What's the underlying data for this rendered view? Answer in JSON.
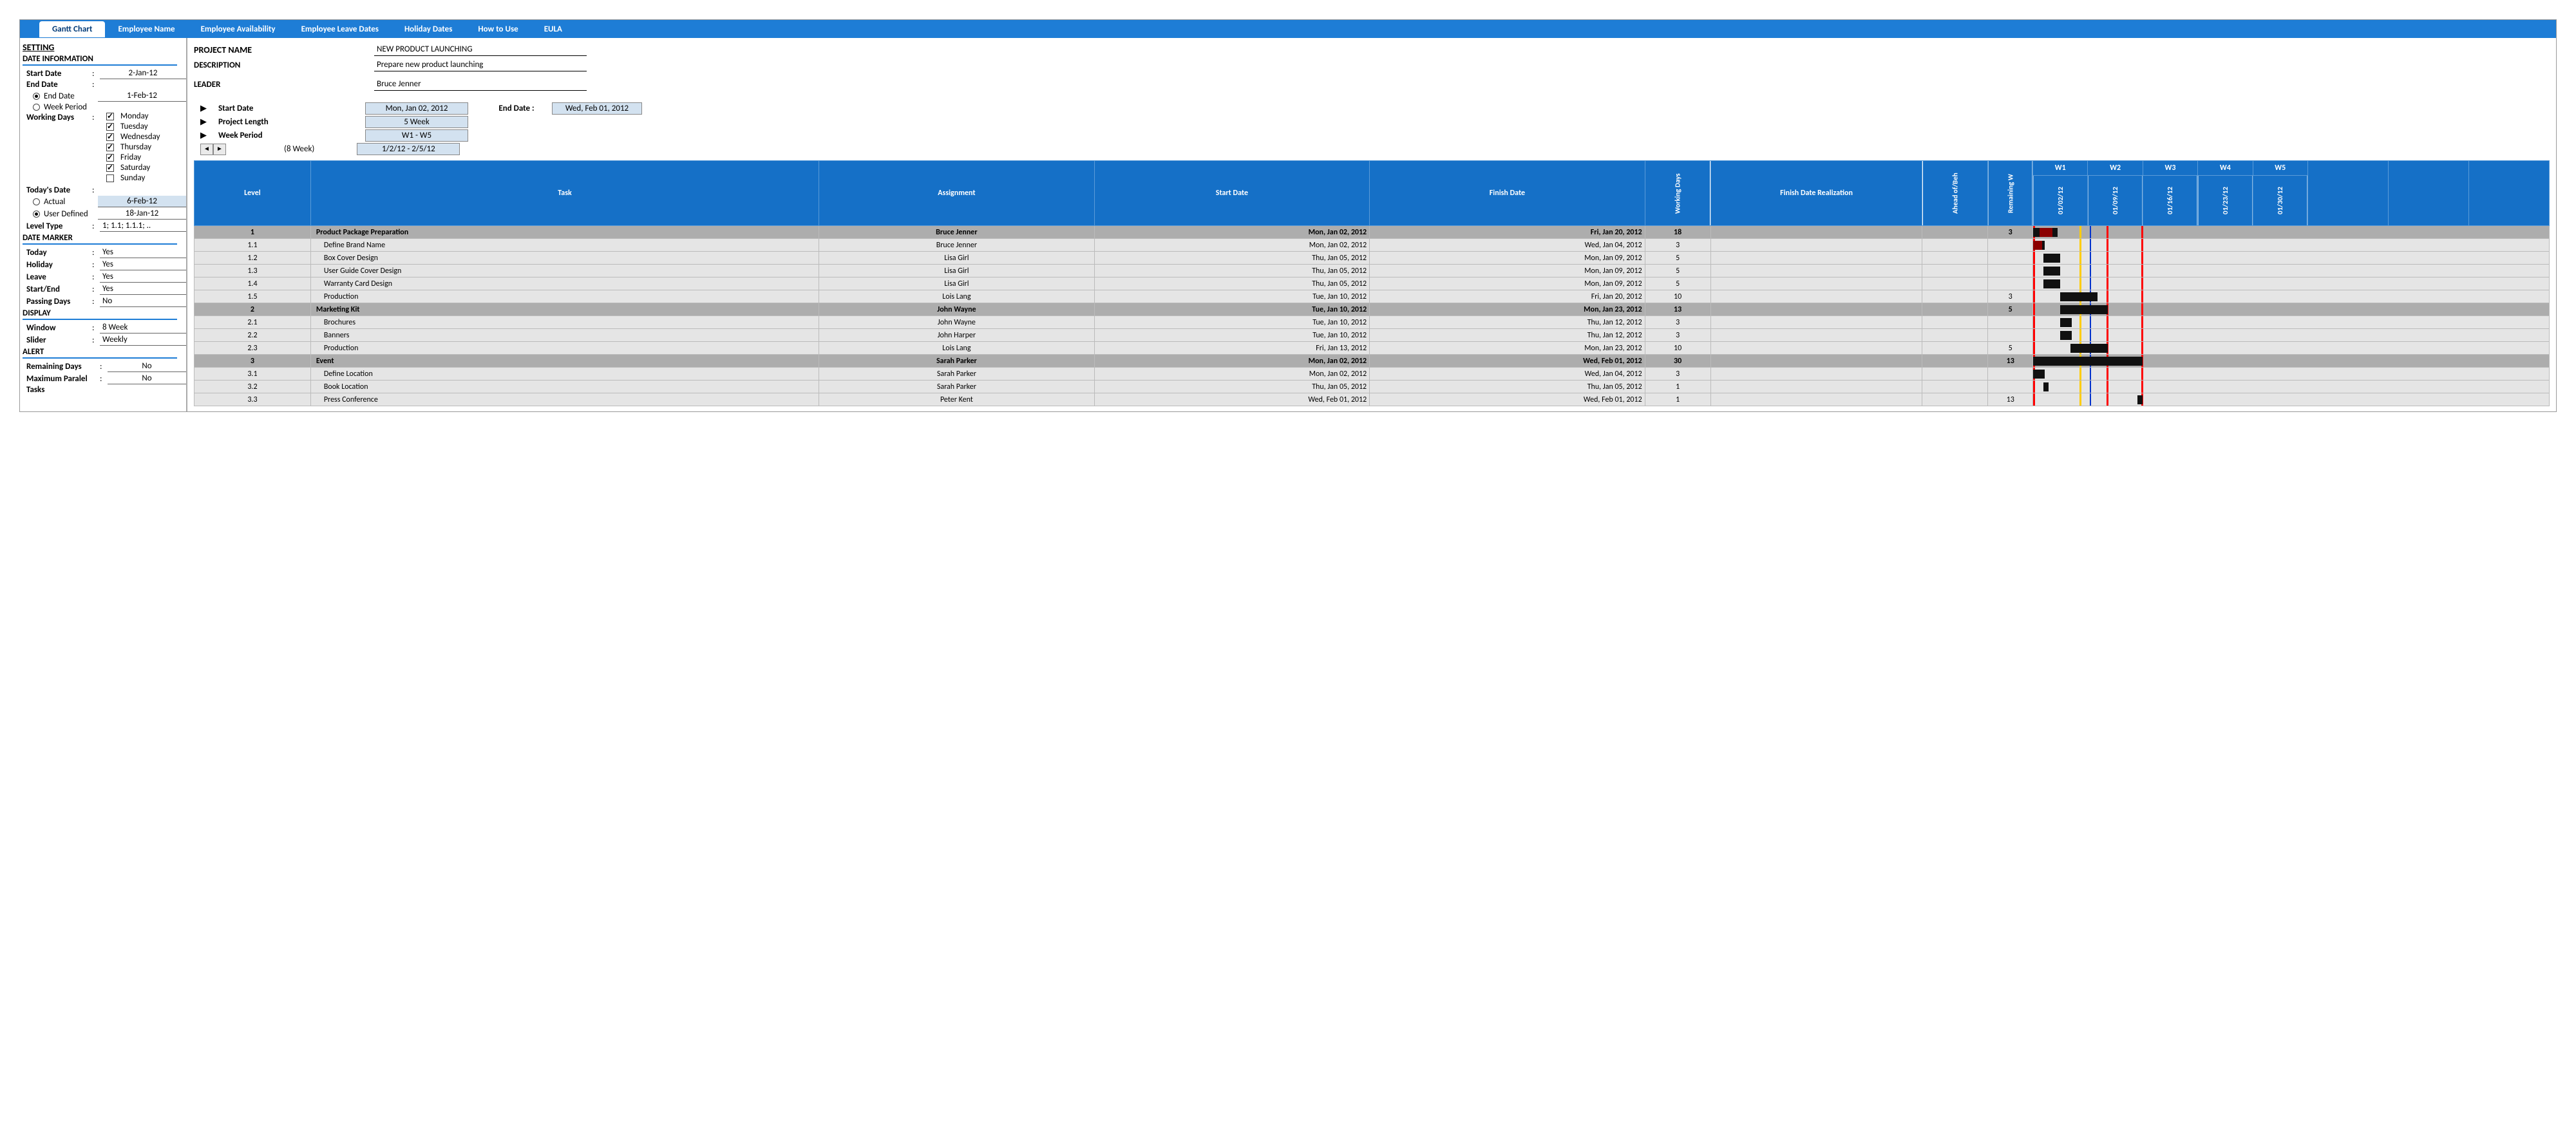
{
  "nav": {
    "tabs": [
      "Gantt Chart",
      "Employee Name",
      "Employee Availability",
      "Employee Leave Dates",
      "Holiday Dates",
      "How to Use",
      "EULA"
    ],
    "active": 0
  },
  "sidebar": {
    "setting": "SETTING",
    "date_info": "DATE INFORMATION",
    "start_date_lbl": "Start Date",
    "start_date_val": "2-Jan-12",
    "end_date_lbl": "End Date",
    "end_date_opt": "End Date",
    "end_date_val": "1-Feb-12",
    "week_period_opt": "Week Period",
    "working_days_lbl": "Working Days",
    "days": [
      {
        "name": "Monday",
        "checked": true
      },
      {
        "name": "Tuesday",
        "checked": true
      },
      {
        "name": "Wednesday",
        "checked": true
      },
      {
        "name": "Thursday",
        "checked": true
      },
      {
        "name": "Friday",
        "checked": true
      },
      {
        "name": "Saturday",
        "checked": true
      },
      {
        "name": "Sunday",
        "checked": false
      }
    ],
    "todays_date_lbl": "Today's Date",
    "actual_opt": "Actual",
    "actual_val": "6-Feb-12",
    "user_def_opt": "User Defined",
    "user_def_val": "18-Jan-12",
    "level_type_lbl": "Level Type",
    "level_type_val": "1; 1.1; 1.1.1; ..",
    "date_marker": "DATE MARKER",
    "markers": [
      {
        "label": "Today",
        "val": "Yes"
      },
      {
        "label": "Holiday",
        "val": "Yes"
      },
      {
        "label": "Leave",
        "val": "Yes"
      },
      {
        "label": "Start/End",
        "val": "Yes"
      },
      {
        "label": "Passing Days",
        "val": "No"
      }
    ],
    "display": "DISPLAY",
    "window_lbl": "Window",
    "window_val": "8 Week",
    "slider_lbl": "Slider",
    "slider_val": "Weekly",
    "alert": "ALERT",
    "remaining_lbl": "Remaining Days",
    "remaining_val": "No",
    "max_parallel_lbl": "Maximum Paralel",
    "max_parallel_val": "No",
    "tasks_lbl": "Tasks"
  },
  "project": {
    "name_lbl": "PROJECT NAME",
    "name_val": "NEW PRODUCT LAUNCHING",
    "desc_lbl": "DESCRIPTION",
    "desc_val": "Prepare new product launching",
    "leader_lbl": "LEADER",
    "leader_val": "Bruce Jenner",
    "start_date_lbl": "Start Date",
    "start_date_val": "Mon, Jan 02, 2012",
    "end_date_lbl": "End Date :",
    "end_date_val": "Wed, Feb 01, 2012",
    "proj_len_lbl": "Project Length",
    "proj_len_val": "5 Week",
    "week_period_lbl": "Week Period",
    "week_period_val": "W1 - W5",
    "weeks_note": "(8 Week)",
    "date_range": "1/2/12 - 2/5/12"
  },
  "table": {
    "headers": {
      "level": "Level",
      "task": "Task",
      "assignment": "Assignment",
      "start": "Start Date",
      "finish": "Finish Date",
      "working": "Working Days",
      "realization": "Finish Date Realization",
      "ahead": "Ahead of/Beh",
      "remaining": "Remaining W"
    },
    "weeks": [
      "W1",
      "W2",
      "W3",
      "W4",
      "W5"
    ],
    "week_dates": [
      "01/02/12",
      "01/09/12",
      "01/16/12",
      "01/23/12",
      "01/30/12"
    ],
    "rows": [
      {
        "parent": true,
        "level": "1",
        "task": "Product Package Preparation",
        "assign": "Bruce Jenner",
        "start": "Mon, Jan 02, 2012",
        "finish": "Fri, Jan 20, 2012",
        "days": "18",
        "real": "",
        "ahead": "",
        "remain": "3"
      },
      {
        "parent": false,
        "level": "1.1",
        "task": "Define Brand Name",
        "assign": "Bruce Jenner",
        "start": "Mon, Jan 02, 2012",
        "finish": "Wed, Jan 04, 2012",
        "days": "3",
        "real": "",
        "ahead": "",
        "remain": ""
      },
      {
        "parent": false,
        "level": "1.2",
        "task": "Box Cover Design",
        "assign": "Lisa Girl",
        "start": "Thu, Jan 05, 2012",
        "finish": "Mon, Jan 09, 2012",
        "days": "5",
        "real": "",
        "ahead": "",
        "remain": ""
      },
      {
        "parent": false,
        "level": "1.3",
        "task": "User Guide Cover Design",
        "assign": "Lisa Girl",
        "start": "Thu, Jan 05, 2012",
        "finish": "Mon, Jan 09, 2012",
        "days": "5",
        "real": "",
        "ahead": "",
        "remain": ""
      },
      {
        "parent": false,
        "level": "1.4",
        "task": "Warranty Card Design",
        "assign": "Lisa Girl",
        "start": "Thu, Jan 05, 2012",
        "finish": "Mon, Jan 09, 2012",
        "days": "5",
        "real": "",
        "ahead": "",
        "remain": ""
      },
      {
        "parent": false,
        "level": "1.5",
        "task": "Production",
        "assign": "Lois Lang",
        "start": "Tue, Jan 10, 2012",
        "finish": "Fri, Jan 20, 2012",
        "days": "10",
        "real": "",
        "ahead": "",
        "remain": "3"
      },
      {
        "parent": true,
        "level": "2",
        "task": "Marketing Kit",
        "assign": "John Wayne",
        "start": "Tue, Jan 10, 2012",
        "finish": "Mon, Jan 23, 2012",
        "days": "13",
        "real": "",
        "ahead": "",
        "remain": "5"
      },
      {
        "parent": false,
        "level": "2.1",
        "task": "Brochures",
        "assign": "John Wayne",
        "start": "Tue, Jan 10, 2012",
        "finish": "Thu, Jan 12, 2012",
        "days": "3",
        "real": "",
        "ahead": "",
        "remain": ""
      },
      {
        "parent": false,
        "level": "2.2",
        "task": "Banners",
        "assign": "John Harper",
        "start": "Tue, Jan 10, 2012",
        "finish": "Thu, Jan 12, 2012",
        "days": "3",
        "real": "",
        "ahead": "",
        "remain": ""
      },
      {
        "parent": false,
        "level": "2.3",
        "task": "Production",
        "assign": "Lois Lang",
        "start": "Fri, Jan 13, 2012",
        "finish": "Mon, Jan 23, 2012",
        "days": "10",
        "real": "",
        "ahead": "",
        "remain": "5"
      },
      {
        "parent": true,
        "level": "3",
        "task": "Event",
        "assign": "Sarah Parker",
        "start": "Mon, Jan 02, 2012",
        "finish": "Wed, Feb 01, 2012",
        "days": "30",
        "real": "",
        "ahead": "",
        "remain": "13"
      },
      {
        "parent": false,
        "level": "3.1",
        "task": "Define Location",
        "assign": "Sarah Parker",
        "start": "Mon, Jan 02, 2012",
        "finish": "Wed, Jan 04, 2012",
        "days": "3",
        "real": "",
        "ahead": "",
        "remain": ""
      },
      {
        "parent": false,
        "level": "3.2",
        "task": "Book Location",
        "assign": "Sarah Parker",
        "start": "Thu, Jan 05, 2012",
        "finish": "Thu, Jan 05, 2012",
        "days": "1",
        "real": "",
        "ahead": "",
        "remain": ""
      },
      {
        "parent": false,
        "level": "3.3",
        "task": "Press Conference",
        "assign": "Peter Kent",
        "start": "Wed, Feb 01, 2012",
        "finish": "Wed, Feb 01, 2012",
        "days": "1",
        "real": "",
        "ahead": "",
        "remain": "13"
      }
    ]
  }
}
